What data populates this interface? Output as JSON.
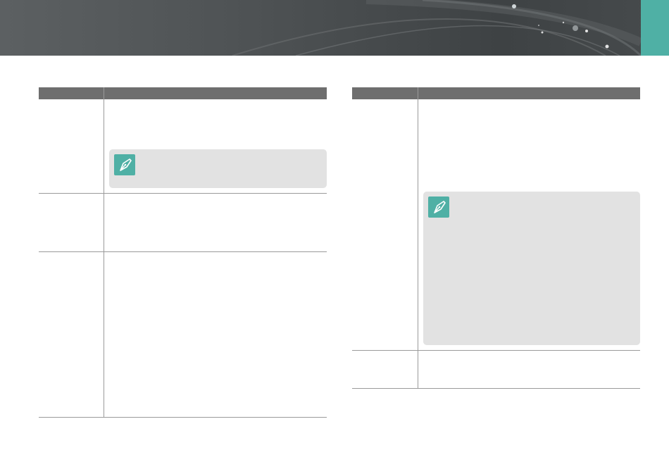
{
  "banner": {
    "accent_color": "#4fb0a5",
    "background_color": "#4d5153"
  },
  "left_table": {
    "header": {
      "col1": "",
      "col2": ""
    },
    "rows": [
      {
        "label": "",
        "text": "",
        "note": ""
      },
      {
        "label": "",
        "text": ""
      },
      {
        "label": "",
        "text": ""
      }
    ]
  },
  "right_table": {
    "header": {
      "col1": "",
      "col2": ""
    },
    "rows": [
      {
        "label": "",
        "text": "",
        "note": ""
      },
      {
        "label": "",
        "text": ""
      }
    ]
  },
  "icons": {
    "note": "pen-nib-icon"
  }
}
